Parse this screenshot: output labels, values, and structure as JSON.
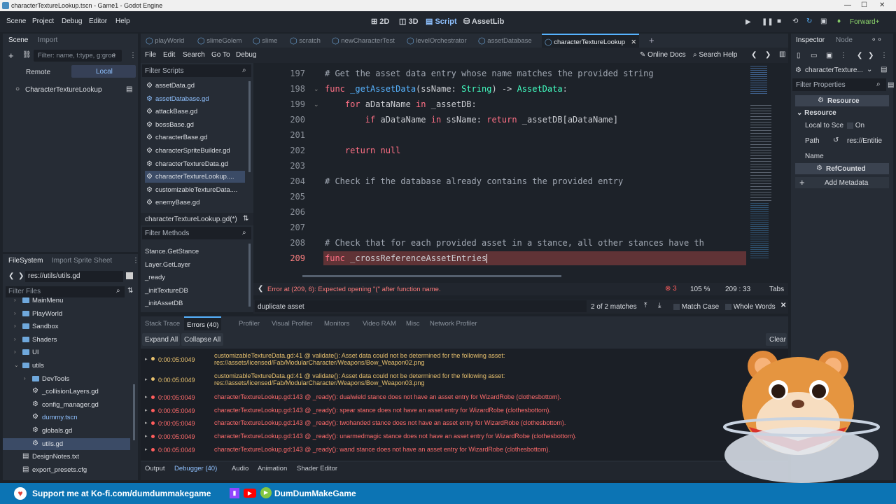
{
  "window": {
    "title": "characterTextureLookup.tscn - Game1 - Godot Engine"
  },
  "menu": [
    "Scene",
    "Project",
    "Debug",
    "Editor",
    "Help"
  ],
  "modes": [
    "2D",
    "3D",
    "Script",
    "AssetLib"
  ],
  "renderer": "Forward+",
  "scene_panel": {
    "tabs": [
      "Scene",
      "Import"
    ],
    "filter_placeholder": "Filter: name, t:type, g:grou",
    "remote": "Remote",
    "local": "Local",
    "root_node": "CharacterTextureLookup"
  },
  "filesystem": {
    "tabs": [
      "FileSystem",
      "Import Sprite Sheet"
    ],
    "path": "res://utils/utils.gd",
    "filter_placeholder": "Filter Files",
    "items": [
      {
        "label": "MainMenu",
        "indent": 1
      },
      {
        "label": "PlayWorld",
        "indent": 1
      },
      {
        "label": "Sandbox",
        "indent": 1
      },
      {
        "label": "Shaders",
        "indent": 1
      },
      {
        "label": "UI",
        "indent": 1
      },
      {
        "label": "utils",
        "indent": 1
      },
      {
        "label": "DevTools",
        "indent": 2
      },
      {
        "label": "_collisionLayers.gd",
        "indent": 2
      },
      {
        "label": "config_manager.gd",
        "indent": 2
      },
      {
        "label": "dummy.tscn",
        "indent": 2
      },
      {
        "label": "globals.gd",
        "indent": 2
      },
      {
        "label": "utils.gd",
        "indent": 2
      },
      {
        "label": "DesignNotes.txt",
        "indent": 0
      },
      {
        "label": "export_presets.cfg",
        "indent": 0
      }
    ]
  },
  "script_tabs": [
    "playWorld",
    "slimeGolem",
    "slime",
    "scratch",
    "newCharacterTest",
    "levelOrchestrator",
    "assetDatabase",
    "characterTextureLookup"
  ],
  "script_menu": [
    "File",
    "Edit",
    "Search",
    "Go To",
    "Debug"
  ],
  "script_toolbar": {
    "online_docs": "Online Docs",
    "search_help": "Search Help"
  },
  "script_list": {
    "filter_placeholder": "Filter Scripts",
    "items": [
      "assetData.gd",
      "assetDatabase.gd",
      "attackBase.gd",
      "bossBase.gd",
      "characterBase.gd",
      "characterSpriteBuilder.gd",
      "characterTextureData.gd",
      "characterTextureLookup....",
      "customizableTextureData....",
      "enemyBase.gd"
    ],
    "current": "characterTextureLookup.gd(*)",
    "methods_placeholder": "Filter Methods",
    "methods": [
      "Stance.GetStance",
      "Layer.GetLayer",
      "_ready",
      "_initTextureDB",
      "_initAssetDB"
    ]
  },
  "code": {
    "lines": [
      {
        "n": "197",
        "tokens": [
          {
            "t": "# Get the asset data entry whose name matches the provided string",
            "c": "cm"
          }
        ]
      },
      {
        "n": "198",
        "tokens": [
          {
            "t": "func ",
            "c": "kw"
          },
          {
            "t": "_getAssetData",
            "c": "fn"
          },
          {
            "t": "(ssName: ",
            "c": "id"
          },
          {
            "t": "String",
            "c": "ty"
          },
          {
            "t": ") -> ",
            "c": "id"
          },
          {
            "t": "AssetData",
            "c": "ty"
          },
          {
            "t": ":",
            "c": "id"
          }
        ]
      },
      {
        "n": "199",
        "tokens": [
          {
            "t": "    for ",
            "c": "kw"
          },
          {
            "t": "aDataName ",
            "c": "id"
          },
          {
            "t": "in ",
            "c": "kw"
          },
          {
            "t": "_assetDB:",
            "c": "id"
          }
        ]
      },
      {
        "n": "200",
        "tokens": [
          {
            "t": "        if ",
            "c": "kw"
          },
          {
            "t": "aDataName ",
            "c": "id"
          },
          {
            "t": "in ",
            "c": "kw"
          },
          {
            "t": "ssName: ",
            "c": "id"
          },
          {
            "t": "return ",
            "c": "kw"
          },
          {
            "t": "_assetDB[aDataName]",
            "c": "id"
          }
        ]
      },
      {
        "n": "201",
        "tokens": []
      },
      {
        "n": "202",
        "tokens": [
          {
            "t": "    return ",
            "c": "kw"
          },
          {
            "t": "null",
            "c": "kw"
          }
        ]
      },
      {
        "n": "203",
        "tokens": []
      },
      {
        "n": "204",
        "tokens": [
          {
            "t": "# Check if the database already contains the provided entry",
            "c": "cm"
          }
        ]
      },
      {
        "n": "205",
        "tokens": []
      },
      {
        "n": "206",
        "tokens": []
      },
      {
        "n": "207",
        "tokens": []
      },
      {
        "n": "208",
        "tokens": [
          {
            "t": "# Check that for each provided asset in a stance, all other stances have th",
            "c": "cm"
          }
        ]
      },
      {
        "n": "209",
        "tokens": [
          {
            "t": "func ",
            "c": "kw"
          },
          {
            "t": "_crossReferenceAssetEntries",
            "c": "id"
          }
        ]
      }
    ]
  },
  "status": {
    "error": "Error at (209, 6): Expected opening \"(\" after function name.",
    "error_count": "3",
    "zoom": "105 %",
    "position": "209 : 33",
    "indent": "Tabs"
  },
  "search": {
    "query": "duplicate asset",
    "matches": "2 of 2 matches",
    "match_case": "Match Case",
    "whole_words": "Whole Words"
  },
  "debugger": {
    "tabs": [
      "Stack Trace",
      "Errors (40)",
      "Profiler",
      "Visual Profiler",
      "Monitors",
      "Video RAM",
      "Misc",
      "Network Profiler"
    ],
    "expand": "Expand All",
    "collapse": "Collapse All",
    "clear": "Clear",
    "errors": [
      {
        "time": "0:00:05:0049",
        "msg": "customizableTextureData.gd:41 @ validate(): Asset data could not be determined for the following asset:",
        "msg2": "res://assets/licensed/Fab/ModularCharacter/Weapons/Bow_Weapon02.png",
        "level": "warn"
      },
      {
        "time": "0:00:05:0049",
        "msg": "customizableTextureData.gd:41 @ validate(): Asset data could not be determined for the following asset:",
        "msg2": "res://assets/licensed/Fab/ModularCharacter/Weapons/Bow_Weapon03.png",
        "level": "warn"
      },
      {
        "time": "0:00:05:0049",
        "msg": "characterTextureLookup.gd:143 @ _ready(): dualwield stance does not have an asset entry for WizardRobe (clothesbottom).",
        "msg2": "",
        "level": "err"
      },
      {
        "time": "0:00:05:0049",
        "msg": "characterTextureLookup.gd:143 @ _ready(): spear stance does not have an asset entry for WizardRobe (clothesbottom).",
        "msg2": "",
        "level": "err"
      },
      {
        "time": "0:00:05:0049",
        "msg": "characterTextureLookup.gd:143 @ _ready(): twohanded stance does not have an asset entry for WizardRobe (clothesbottom).",
        "msg2": "",
        "level": "err"
      },
      {
        "time": "0:00:05:0049",
        "msg": "characterTextureLookup.gd:143 @ _ready(): unarmedmagic stance does not have an asset entry for WizardRobe (clothesbottom).",
        "msg2": "",
        "level": "err"
      },
      {
        "time": "0:00:05:0049",
        "msg": "characterTextureLookup.gd:143 @ _ready(): wand stance does not have an asset entry for WizardRobe (clothesbottom).",
        "msg2": "",
        "level": "err"
      }
    ]
  },
  "bottom_tabs": [
    "Output",
    "Debugger (40)",
    "Audio",
    "Animation",
    "Shader Editor"
  ],
  "inspector": {
    "tabs": [
      "Inspector",
      "Node"
    ],
    "object": "characterTexture...",
    "filter_placeholder": "Filter Properties",
    "resource_header": "Resource",
    "resource_section": "Resource",
    "local_to_scene": "Local to Sce",
    "local_value": "On",
    "path_label": "Path",
    "path_value": "res://Entitie",
    "name_label": "Name",
    "refcounted": "RefCounted",
    "add_metadata": "Add Metadata"
  },
  "footer": {
    "kofi": "Support me at Ko-fi.com/dumdummakegame",
    "channel": "DumDumMakeGame"
  },
  "colors": {
    "accent": "#57b3ff",
    "error": "#ff5d5d",
    "warning": "#e8c16e",
    "footer": "#0c74b4"
  }
}
